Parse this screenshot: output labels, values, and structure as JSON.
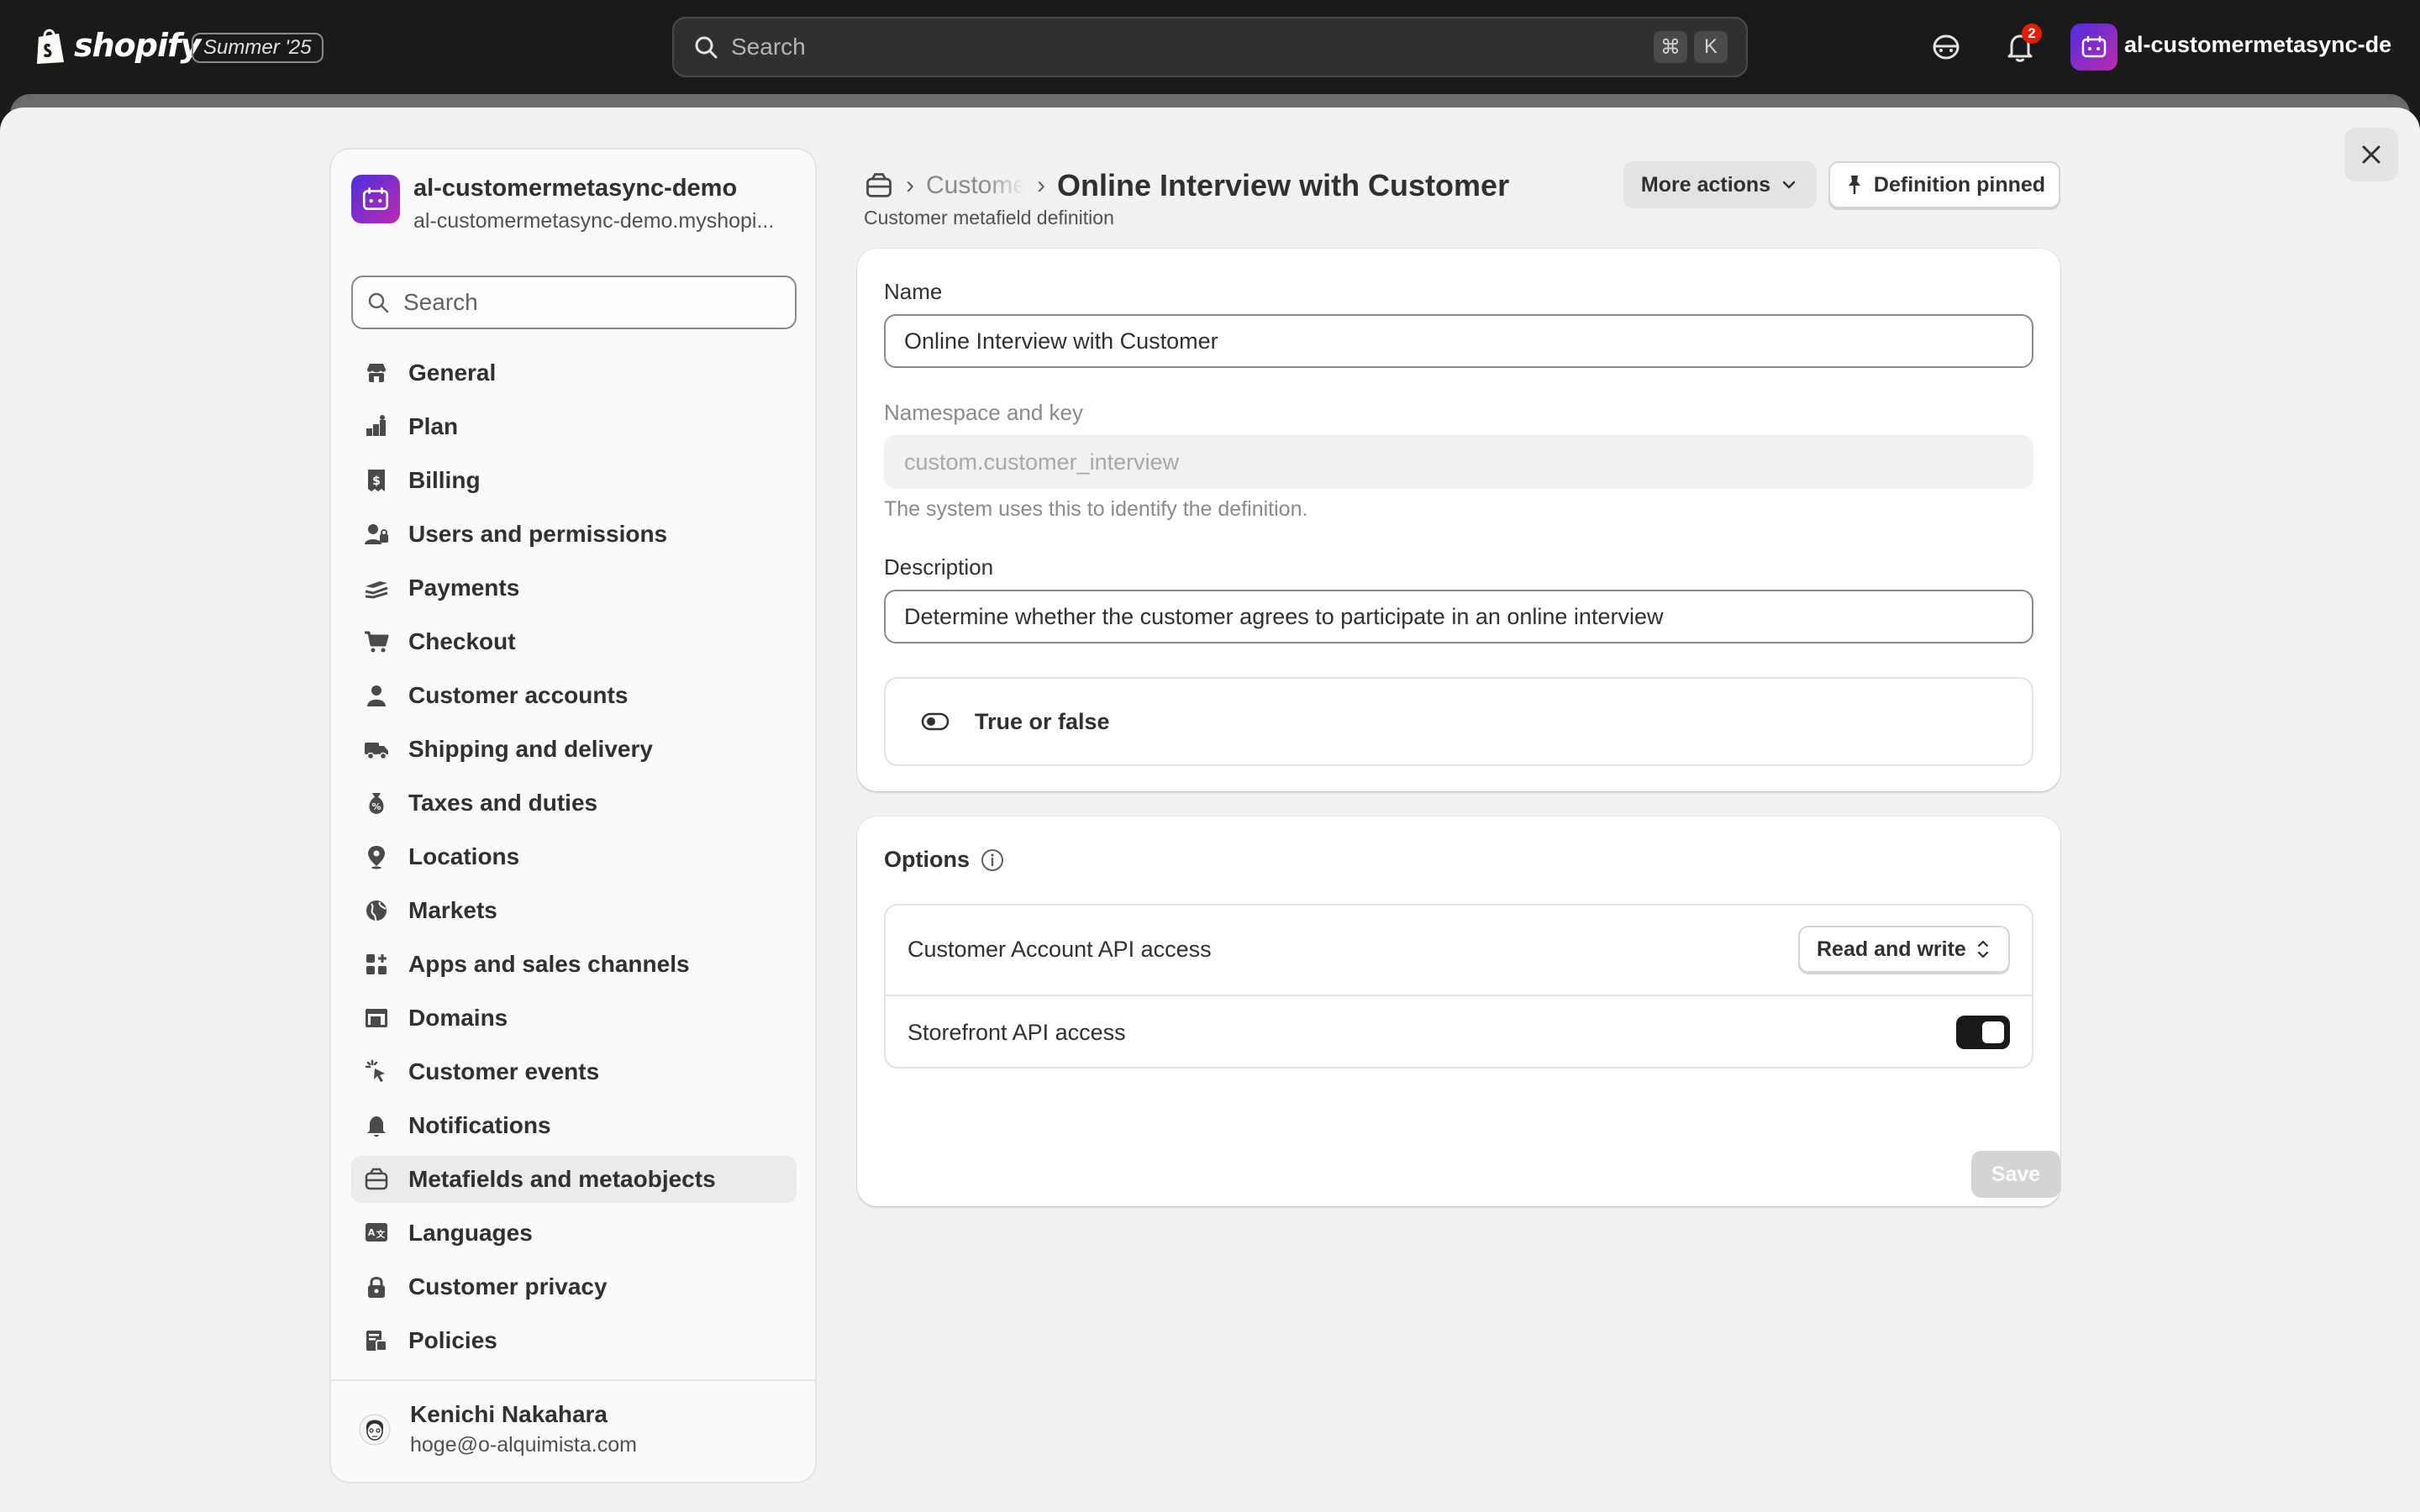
{
  "topbar": {
    "brand": "shopify",
    "edition": "Summer '25",
    "search_placeholder": "Search",
    "shortcut_keys": [
      "⌘",
      "K"
    ],
    "notification_count": "2",
    "store_name": "al-customermetasync-de..."
  },
  "sidebar": {
    "store_name": "al-customermetasync-demo",
    "store_domain": "al-customermetasync-demo.myshopi...",
    "search_placeholder": "Search",
    "items": [
      {
        "label": "General",
        "icon": "store-icon"
      },
      {
        "label": "Plan",
        "icon": "plan-icon"
      },
      {
        "label": "Billing",
        "icon": "billing-icon"
      },
      {
        "label": "Users and permissions",
        "icon": "users-icon"
      },
      {
        "label": "Payments",
        "icon": "payments-icon"
      },
      {
        "label": "Checkout",
        "icon": "cart-icon"
      },
      {
        "label": "Customer accounts",
        "icon": "person-icon"
      },
      {
        "label": "Shipping and delivery",
        "icon": "truck-icon"
      },
      {
        "label": "Taxes and duties",
        "icon": "taxes-icon"
      },
      {
        "label": "Locations",
        "icon": "location-pin-icon"
      },
      {
        "label": "Markets",
        "icon": "globe-icon"
      },
      {
        "label": "Apps and sales channels",
        "icon": "apps-icon"
      },
      {
        "label": "Domains",
        "icon": "domains-icon"
      },
      {
        "label": "Customer events",
        "icon": "cursor-click-icon"
      },
      {
        "label": "Notifications",
        "icon": "bell-icon"
      },
      {
        "label": "Metafields and metaobjects",
        "icon": "metafields-icon",
        "active": true
      },
      {
        "label": "Languages",
        "icon": "languages-icon"
      },
      {
        "label": "Customer privacy",
        "icon": "lock-icon"
      },
      {
        "label": "Policies",
        "icon": "policies-icon"
      }
    ],
    "user": {
      "name": "Kenichi Nakahara",
      "email": "hoge@o-alquimista.com"
    }
  },
  "header": {
    "breadcrumb_parent": "Customers",
    "title": "Online Interview with Customer",
    "subtitle": "Customer metafield definition",
    "more_actions_label": "More actions",
    "pinned_label": "Definition pinned"
  },
  "form": {
    "name_label": "Name",
    "name_value": "Online Interview with Customer",
    "namespace_label": "Namespace and key",
    "namespace_value": "custom.customer_interview",
    "namespace_help": "The system uses this to identify the definition.",
    "description_label": "Description",
    "description_value": "Determine whether the customer agrees to participate in an online interview",
    "type_label": "True or false"
  },
  "options": {
    "title": "Options",
    "customer_account_label": "Customer Account API access",
    "customer_account_value": "Read and write",
    "storefront_label": "Storefront API access",
    "storefront_enabled": true
  },
  "footer": {
    "save_label": "Save"
  },
  "colors": {
    "topbar_bg": "#1a1a1a",
    "page_bg": "#f1f1f1",
    "notification_badge": "#e51c00",
    "toggle_on": "#1a1a1a"
  }
}
